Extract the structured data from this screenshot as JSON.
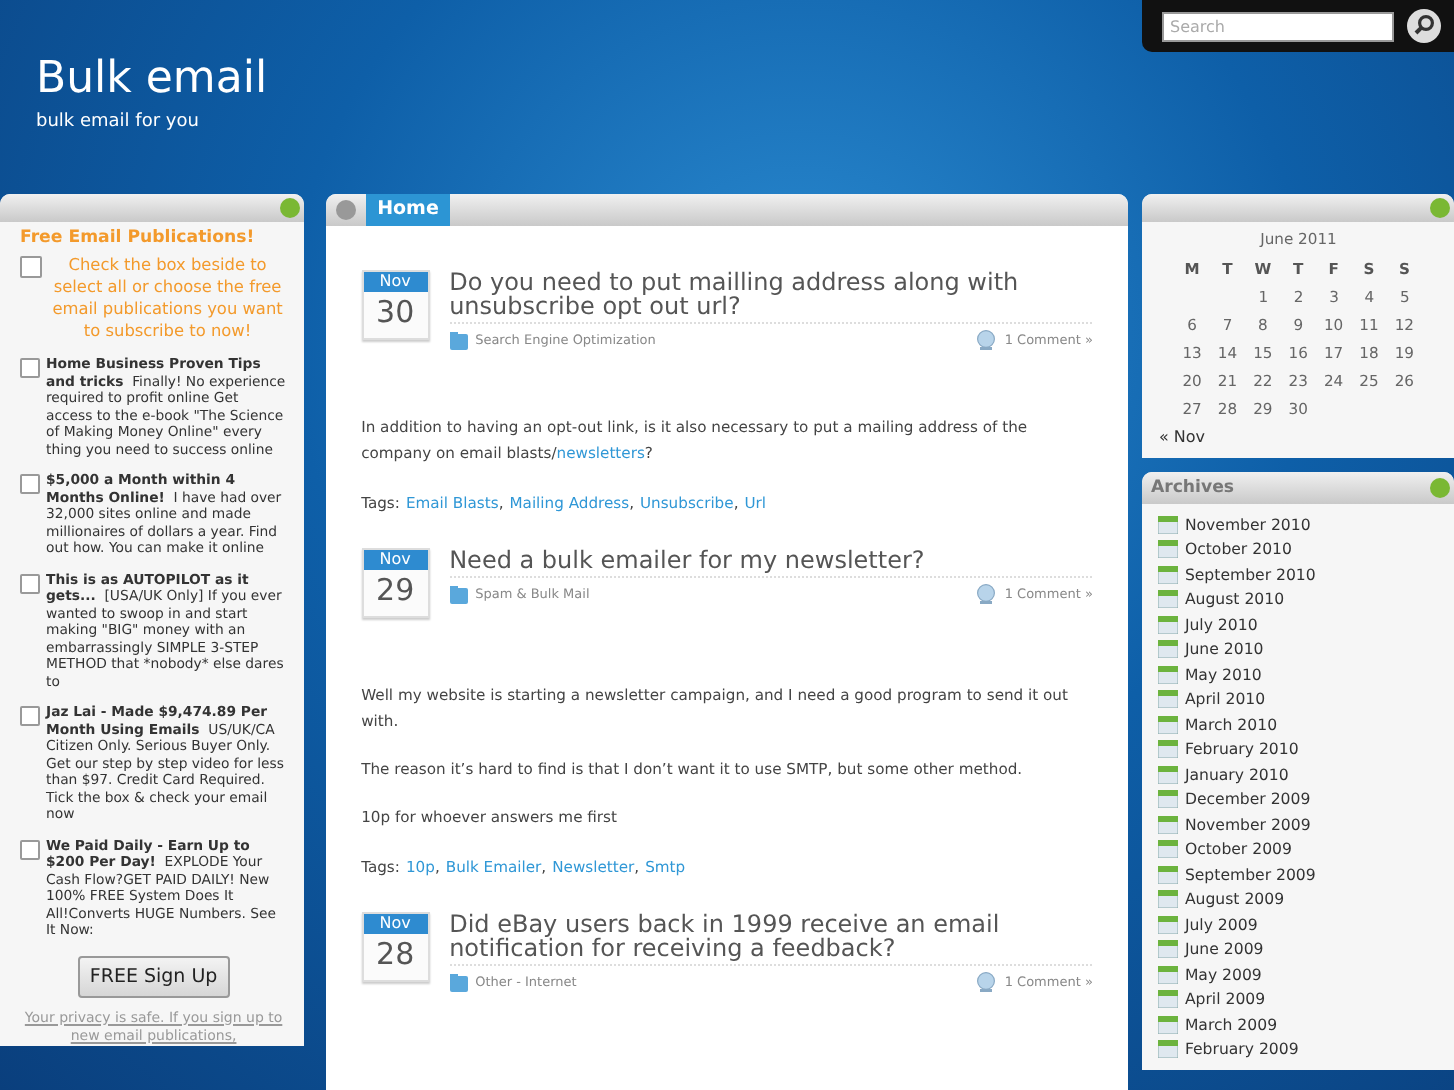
{
  "header": {
    "title": "Bulk email",
    "tagline": "bulk email for you"
  },
  "search": {
    "placeholder": "Search"
  },
  "publications": {
    "heading": "Free Email Publications!",
    "select_all": {
      "label": "Check the box beside to select all or choose the free email publications you want to subscribe to now!",
      "checked": false
    },
    "items": [
      {
        "title": "Home Business Proven Tips and tricks",
        "text": "Finally! No experience required to profit online Get access to the e-book \"The Science of Making Money Online\" every thing you need to success online",
        "checked": false
      },
      {
        "title": "$5,000 a Month within 4 Months Online!",
        "text": "I have had over 32,000 sites online and made millionaires of dollars a year. Find out how. You can make it online",
        "checked": false
      },
      {
        "title": "This is as AUTOPILOT as it gets...",
        "text": "[USA/UK Only] If you ever wanted to swoop in and start making \"BIG\" money with an embarrassingly SIMPLE 3-STEP METHOD that *nobody* else dares to",
        "checked": false
      },
      {
        "title": "Jaz Lai - Made $9,474.89 Per Month Using Emails",
        "text": "US/UK/CA Citizen Only. Serious Buyer Only. Get our step by step video for less than $97. Credit Card Required. Tick the box & check your email now",
        "checked": false
      },
      {
        "title": "We Paid Daily - Earn Up to $200 Per Day!",
        "text": "EXPLODE Your Cash Flow?GET PAID DAILY! New 100% FREE System Does It All!Converts HUGE Numbers. See It Now:",
        "checked": false
      }
    ],
    "button": "FREE Sign Up",
    "privacy": "Your privacy is safe. If you sign up to new email publications,"
  },
  "tabs": [
    {
      "label": "Home",
      "selected": true
    }
  ],
  "posts": [
    {
      "month": "Nov",
      "day": "30",
      "title": "Do you need to put mailling address along with unsubscribe opt out url?",
      "category": "Search Engine Optimization",
      "comments": "1 Comment »",
      "paragraphs": [
        [
          {
            "kind": "text",
            "text": "In addition to having an opt-out link, is it also necessary to put a mailing address of the company on email blasts/"
          },
          {
            "kind": "link",
            "text": "newsletters"
          },
          {
            "kind": "text",
            "text": "?"
          }
        ]
      ],
      "tags_label": "Tags:",
      "tags": [
        {
          "text": "Email Blasts",
          "sep": ","
        },
        {
          "text": "Mailing Address",
          "sep": ","
        },
        {
          "text": "Unsubscribe",
          "sep": ","
        },
        {
          "text": "Url"
        }
      ]
    },
    {
      "month": "Nov",
      "day": "29",
      "title": "Need a bulk emailer for my newsletter?",
      "category": "Spam & Bulk Mail",
      "comments": "1 Comment »",
      "paragraphs": [
        [
          {
            "kind": "text",
            "text": "Well my website is starting a newsletter campaign, and I need a good program to send it out with."
          }
        ],
        [
          {
            "kind": "text",
            "text": "The reason it’s hard to find is that I don’t want it to use SMTP, but some other method."
          }
        ],
        [
          {
            "kind": "text",
            "text": "10p for whoever answers me first"
          }
        ]
      ],
      "tags_label": "Tags:",
      "tags": [
        {
          "text": "10p",
          "sep": ","
        },
        {
          "text": "Bulk Emailer",
          "sep": ","
        },
        {
          "text": "Newsletter",
          "sep": ","
        },
        {
          "text": "Smtp"
        }
      ]
    },
    {
      "month": "Nov",
      "day": "28",
      "title": "Did eBay users back in 1999 receive an email notification for receiving a feedback?",
      "category": "Other - Internet",
      "comments": "1 Comment »"
    }
  ],
  "calendar": {
    "caption": "June 2011",
    "weekdays": [
      "M",
      "T",
      "W",
      "T",
      "F",
      "S",
      "S"
    ],
    "weeks": [
      [
        "1",
        "2",
        "3",
        "4",
        "5"
      ],
      [
        "6",
        "7",
        "8",
        "9",
        "10",
        "11",
        "12"
      ],
      [
        "13",
        "14",
        "15",
        "16",
        "17",
        "18",
        "19"
      ],
      [
        "20",
        "21",
        "22",
        "23",
        "24",
        "25",
        "26"
      ],
      [
        "27",
        "28",
        "29",
        "30"
      ]
    ],
    "prev": "« Nov"
  },
  "archives": {
    "heading": "Archives",
    "items": [
      "November 2010",
      "October 2010",
      "September 2010",
      "August 2010",
      "July 2010",
      "June 2010",
      "May 2010",
      "April 2010",
      "March 2010",
      "February 2010",
      "January 2010",
      "December 2009",
      "November 2009",
      "October 2009",
      "September 2009",
      "August 2009",
      "July 2009",
      "June 2009",
      "May 2009",
      "April 2009",
      "March 2009",
      "February 2009"
    ]
  }
}
